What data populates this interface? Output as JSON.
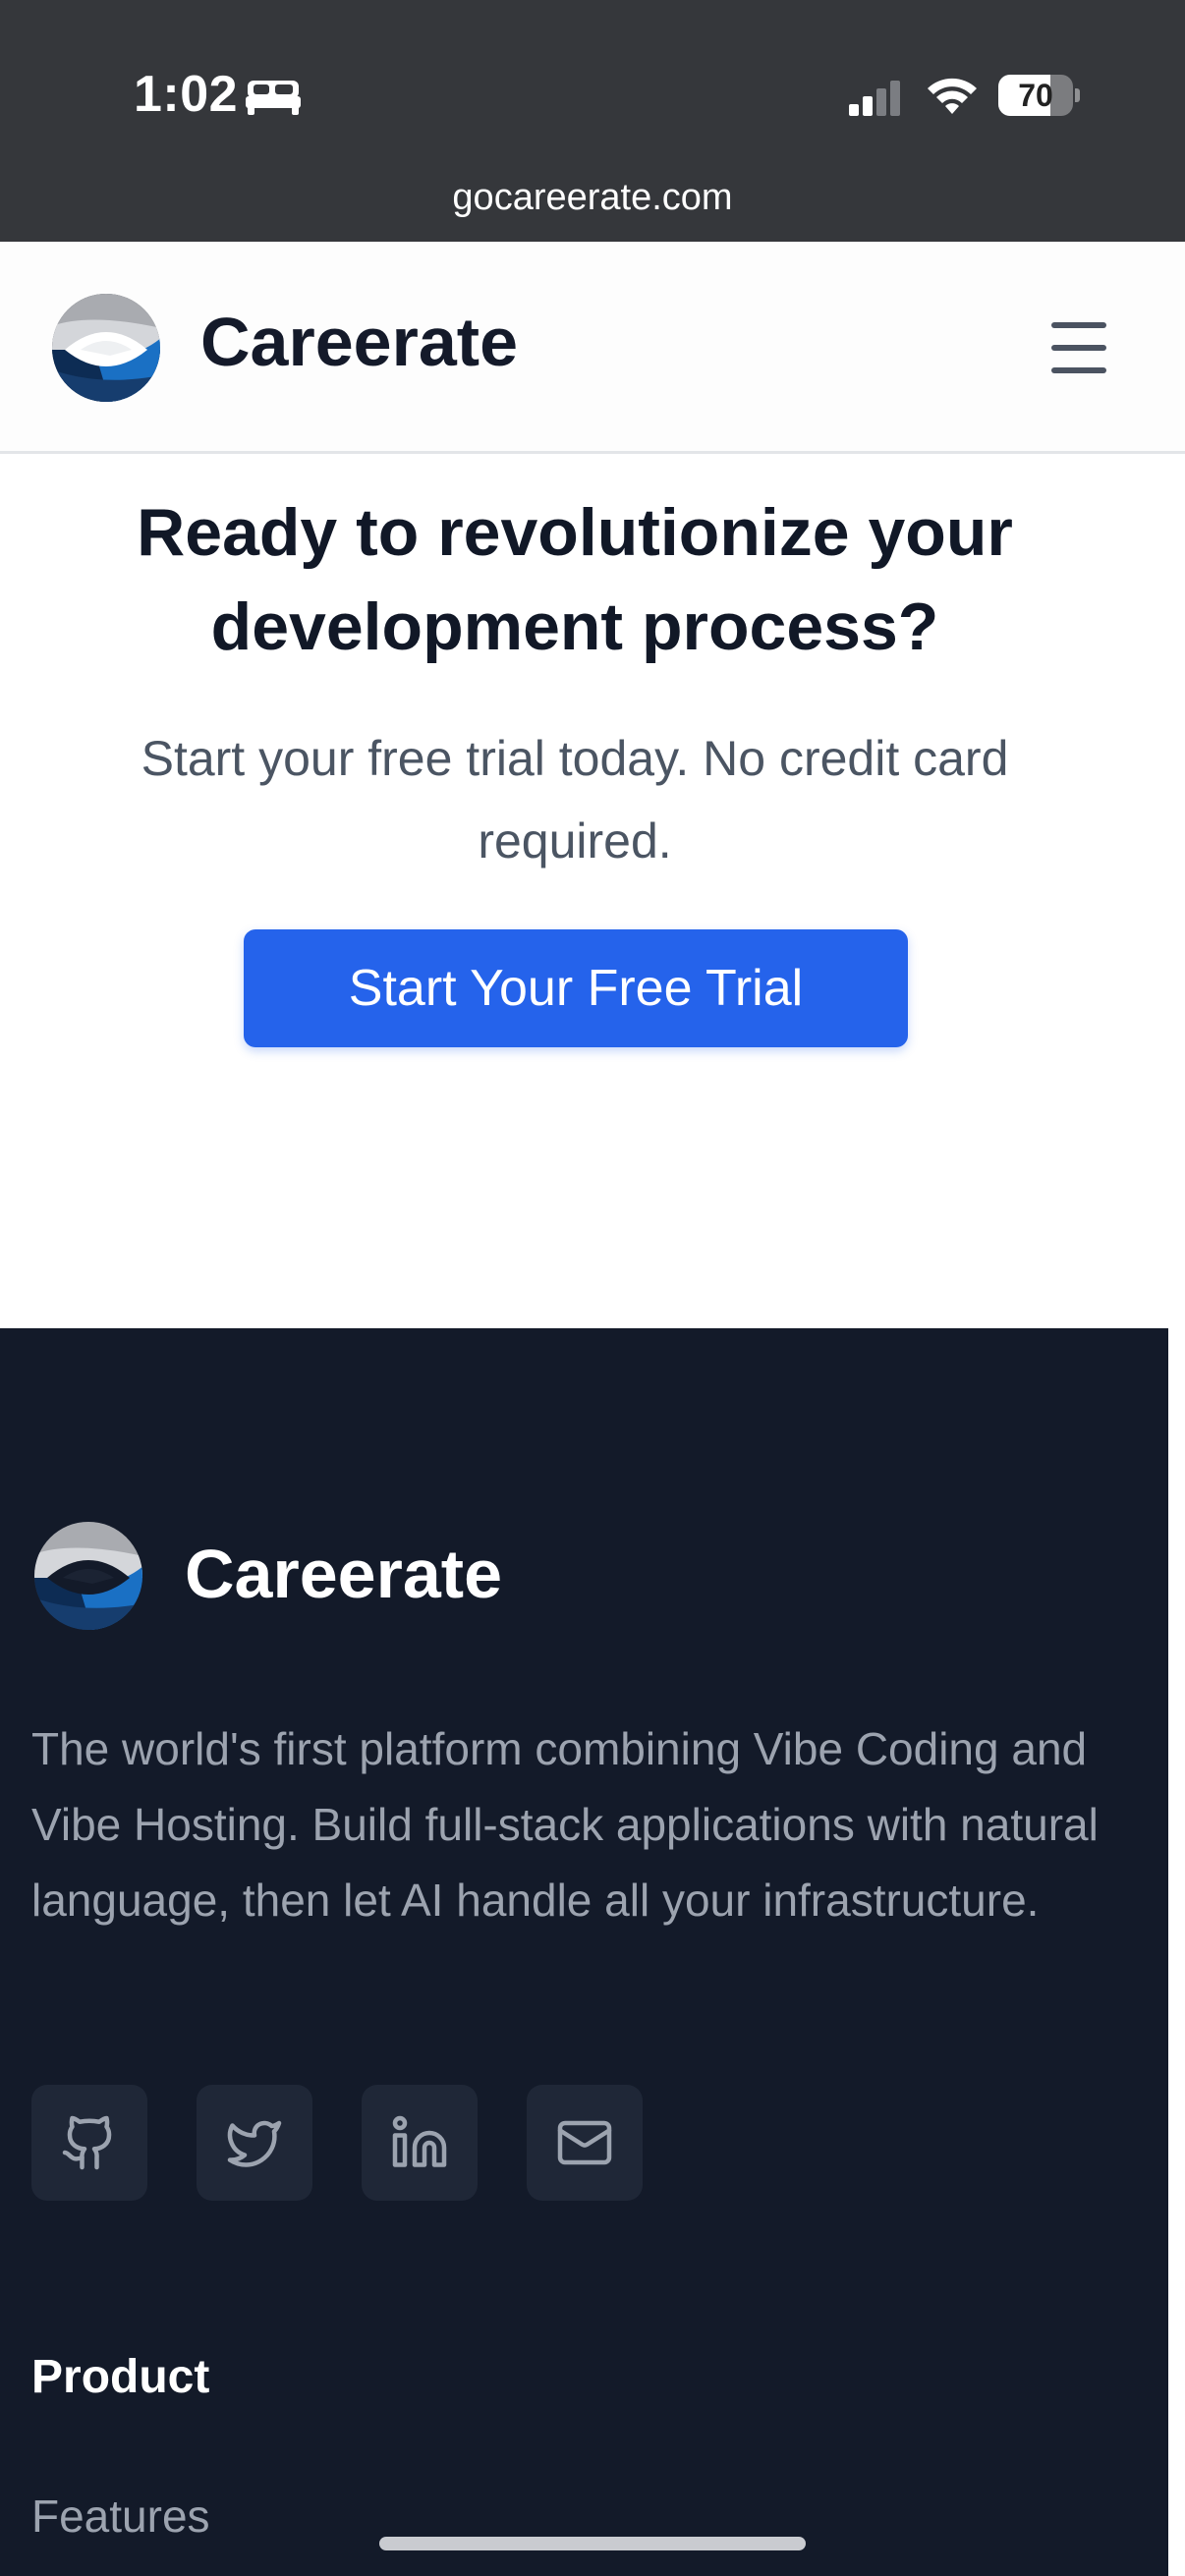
{
  "status_bar": {
    "time": "1:02",
    "battery_level": "70",
    "battery_fraction": 0.7,
    "url": "gocareerate.com"
  },
  "header": {
    "brand": "Careerate"
  },
  "cta": {
    "title": "Ready to revolutionize your development process?",
    "subtitle": "Start your free trial today. No credit card required.",
    "button_label": "Start Your Free Trial"
  },
  "footer": {
    "brand": "Careerate",
    "description": "The world's first platform combining Vibe Coding and Vibe Hosting. Build full-stack applications with natural language, then let AI handle all your infrastructure.",
    "social": [
      "github-icon",
      "twitter-icon",
      "linkedin-icon",
      "mail-icon"
    ],
    "product_heading": "Product",
    "product_links": [
      "Features"
    ]
  },
  "colors": {
    "status_bar_bg": "#35373b",
    "primary_button": "#2563eb",
    "footer_bg": "#131a29",
    "footer_text": "#9ca3af"
  }
}
